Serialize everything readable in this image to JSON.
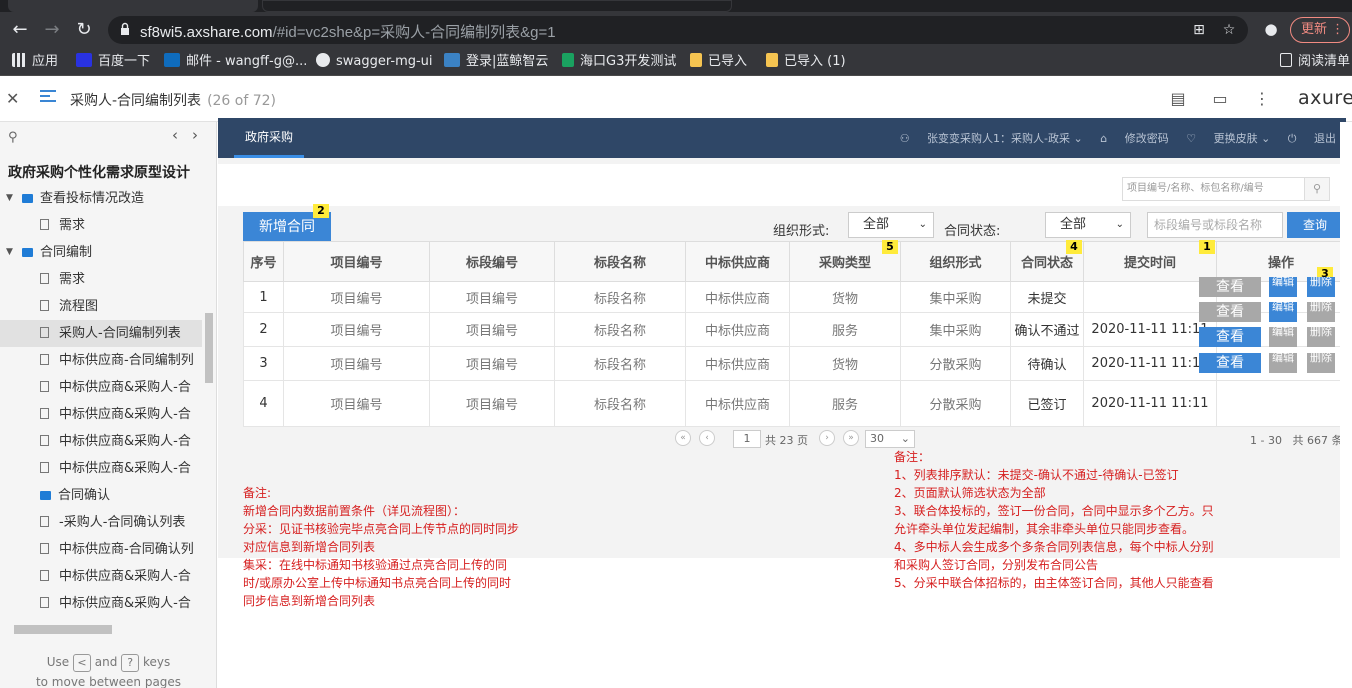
{
  "browser": {
    "url_host": "sf8wi5.axshare.com",
    "url_path": "/#id=vc2she&p=采购人-合同编制列表&g=1",
    "update_label": "更新"
  },
  "bookmarks": [
    "应用",
    "百度一下",
    "邮件 - wangff-g@...",
    "swagger-mg-ui",
    "登录|蓝鲸智云",
    "海口G3开发测试",
    "已导入",
    "已导入 (1)",
    "阅读清单"
  ],
  "axure": {
    "page_title": "采购人-合同编制列表",
    "page_count": "(26 of 72)",
    "logo": "axure"
  },
  "sidebar": {
    "project": "政府采购个性化需求原型设计",
    "tree": [
      {
        "type": "folder",
        "label": "查看投标情况改造",
        "caret": "▼"
      },
      {
        "type": "page",
        "label": "需求"
      },
      {
        "type": "folder",
        "label": "合同编制",
        "caret": "▼"
      },
      {
        "type": "page",
        "label": "需求"
      },
      {
        "type": "page",
        "label": "流程图"
      },
      {
        "type": "page",
        "label": "采购人-合同编制列表",
        "selected": true
      },
      {
        "type": "page",
        "label": "中标供应商-合同编制列"
      },
      {
        "type": "page",
        "label": "中标供应商&采购人-合"
      },
      {
        "type": "page",
        "label": "中标供应商&采购人-合"
      },
      {
        "type": "page",
        "label": "中标供应商&采购人-合"
      },
      {
        "type": "page",
        "label": "中标供应商&采购人-合"
      },
      {
        "type": "folder",
        "label": "合同确认"
      },
      {
        "type": "page",
        "label": "-采购人-合同确认列表"
      },
      {
        "type": "page",
        "label": "中标供应商-合同确认列"
      },
      {
        "type": "page",
        "label": "中标供应商&采购人-合"
      },
      {
        "type": "page",
        "label": "中标供应商&采购人-合"
      }
    ],
    "help_use": "Use",
    "help_and": "and",
    "help_keys": "keys",
    "help_line2": "to move between pages"
  },
  "proto": {
    "header_tab": "政府采购",
    "user_links": [
      "张变变采购人1：采购人-政采",
      "修改密码",
      "更换皮肤",
      "退出"
    ],
    "small_search_placeholder": "项目编号/名称、标包名称/编号",
    "add_button": "新增合同",
    "org_label": "组织形式:",
    "org_value": "全部",
    "status_label": "合同状态:",
    "status_value": "全部",
    "kw_placeholder": "标段编号或标段名称",
    "query_button": "查询",
    "badges": {
      "add": "2",
      "type": "5",
      "status": "4",
      "time": "1",
      "op": "3"
    },
    "columns": [
      "序号",
      "项目编号",
      "标段编号",
      "标段名称",
      "中标供应商",
      "采购类型",
      "组织形式",
      "合同状态",
      "提交时间",
      "操作"
    ],
    "rows": [
      [
        "1",
        "项目编号",
        "项目编号",
        "标段名称",
        "中标供应商",
        "货物",
        "集中采购",
        "未提交",
        ""
      ],
      [
        "2",
        "项目编号",
        "项目编号",
        "标段名称",
        "中标供应商",
        "服务",
        "集中采购",
        "确认不通过",
        "2020-11-11 11:11"
      ],
      [
        "3",
        "项目编号",
        "项目编号",
        "标段名称",
        "中标供应商",
        "货物",
        "分散采购",
        "待确认",
        "2020-11-11 11:11"
      ],
      [
        "4",
        "项目编号",
        "项目编号",
        "标段名称",
        "中标供应商",
        "服务",
        "分散采购",
        "已签订",
        "2020-11-11 11:11"
      ]
    ],
    "op_view": "查看",
    "op_edit": "编辑",
    "op_delete": "删除",
    "pager": {
      "page": "1",
      "total_pages": "共 23 页",
      "page_size": "30",
      "range": "1 - 30",
      "total": "共 667 条"
    }
  },
  "notes_left": {
    "title": "备注:",
    "lines": [
      "新增合同内数据前置条件（详见流程图）：",
      "分采：见证书核验完毕点亮合同上传节点的同时同步",
      "对应信息到新增合同列表",
      "集采：在线中标通知书核验通过点亮合同上传的同",
      "时/或原办公室上传中标通知书点亮合同上传的同时",
      "同步信息到新增合同列表"
    ]
  },
  "notes_right": {
    "title": "备注：",
    "lines": [
      "1、列表排序默认：未提交-确认不通过-待确认-已签订",
      "2、页面默认筛选状态为全部",
      "3、联合体投标的，签订一份合同，合同中显示多个乙方。只",
      "允许牵头单位发起编制，其余非牵头单位只能同步查看。",
      "4、多中标人会生成多个多条合同列表信息，每个中标人分别",
      "和采购人签订合同，分别发布合同公告",
      "5、分采中联合体招标的，由主体签订合同，其他人只能查看"
    ]
  }
}
